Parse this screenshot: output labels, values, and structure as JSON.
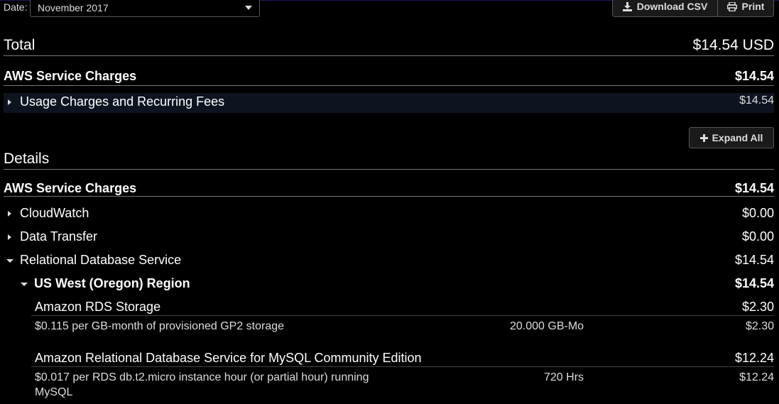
{
  "header": {
    "date_label": "Date:",
    "date_value": "November 2017",
    "download_label": "Download CSV",
    "print_label": "Print"
  },
  "summary": {
    "title": "Total",
    "total": "$14.54 USD",
    "service_label": "AWS Service Charges",
    "service_amount": "$14.54",
    "usage_label": "Usage Charges and Recurring Fees",
    "usage_amount": "$14.54",
    "expand_all_label": "Expand All"
  },
  "details": {
    "title": "Details",
    "service_label": "AWS Service Charges",
    "service_amount": "$14.54",
    "services": [
      {
        "label": "CloudWatch",
        "amount": "$0.00"
      },
      {
        "label": "Data Transfer",
        "amount": "$0.00"
      },
      {
        "label": "Relational Database Service",
        "amount": "$14.54"
      }
    ],
    "region": {
      "label": "US West (Oregon) Region",
      "amount": "$14.54"
    },
    "items": [
      {
        "label": "Amazon RDS Storage",
        "amount": "$2.30",
        "line_desc": "$0.115 per GB-month of provisioned GP2 storage",
        "line_qty": "20.000 GB-Mo",
        "line_amount": "$2.30"
      },
      {
        "label": "Amazon Relational Database Service for MySQL Community Edition",
        "amount": "$12.24",
        "line_desc_1": "$0.017 per RDS db.t2.micro instance hour (or partial hour) running",
        "line_desc_2": "MySQL",
        "line_qty": "720 Hrs",
        "line_amount": "$12.24"
      }
    ]
  }
}
